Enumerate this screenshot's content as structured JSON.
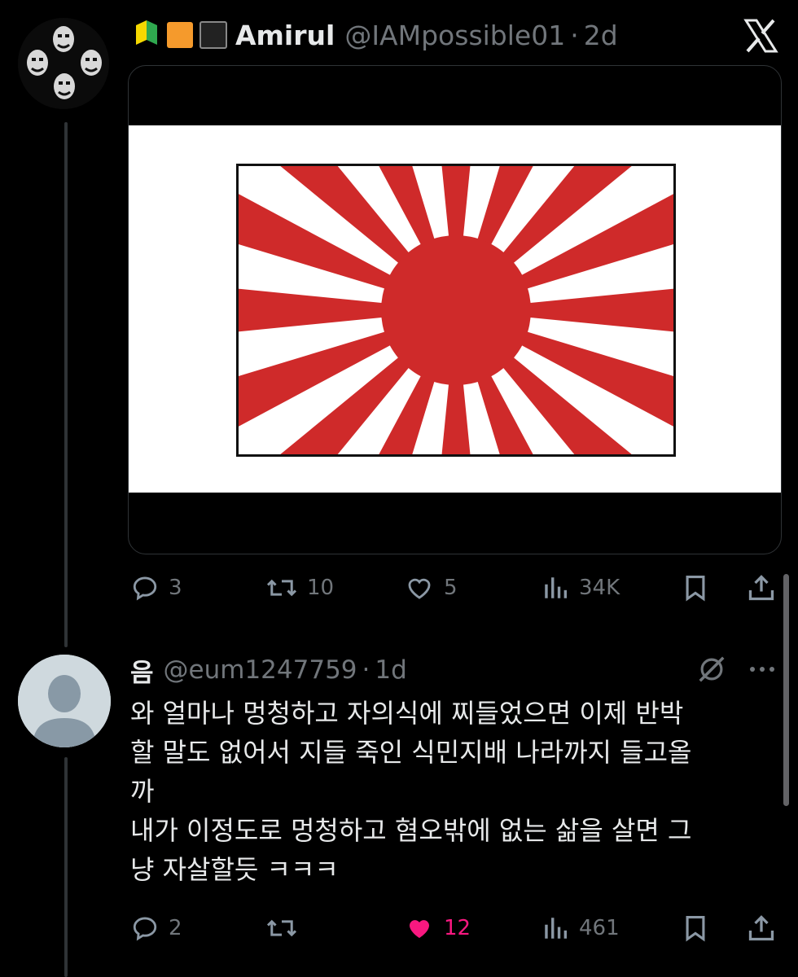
{
  "tweet": {
    "author_name": "Amirul",
    "author_handle": "@IAMpossible01",
    "separator": "·",
    "time": "2d",
    "badges": [
      "beginner-mark-icon",
      "orange-square-icon",
      "black-square-icon"
    ],
    "image": "rising-sun-flag",
    "actions": {
      "replies": "3",
      "reposts": "10",
      "likes": "5",
      "views": "34K"
    }
  },
  "reply": {
    "author_name": "음",
    "author_handle": "@eum1247759",
    "separator": "·",
    "time": "1d",
    "text": "와 얼마나 멍청하고 자의식에 찌들었으면 이제 반박\n할 말도 없어서 지들 죽인 식민지배 나라까지 들고올\n까\n내가 이정도로 멍청하고 혐오밖에 없는 삶을 살면 그\n냥 자살할듯 ㅋㅋㅋ",
    "actions": {
      "replies": "2",
      "reposts": "",
      "likes": "12",
      "views": "461"
    },
    "liked": true
  },
  "colors": {
    "background": "#000000",
    "text": "#e7e9ea",
    "muted": "#71767b",
    "like_active": "#f91880",
    "flag_red": "#cf2a2a"
  }
}
